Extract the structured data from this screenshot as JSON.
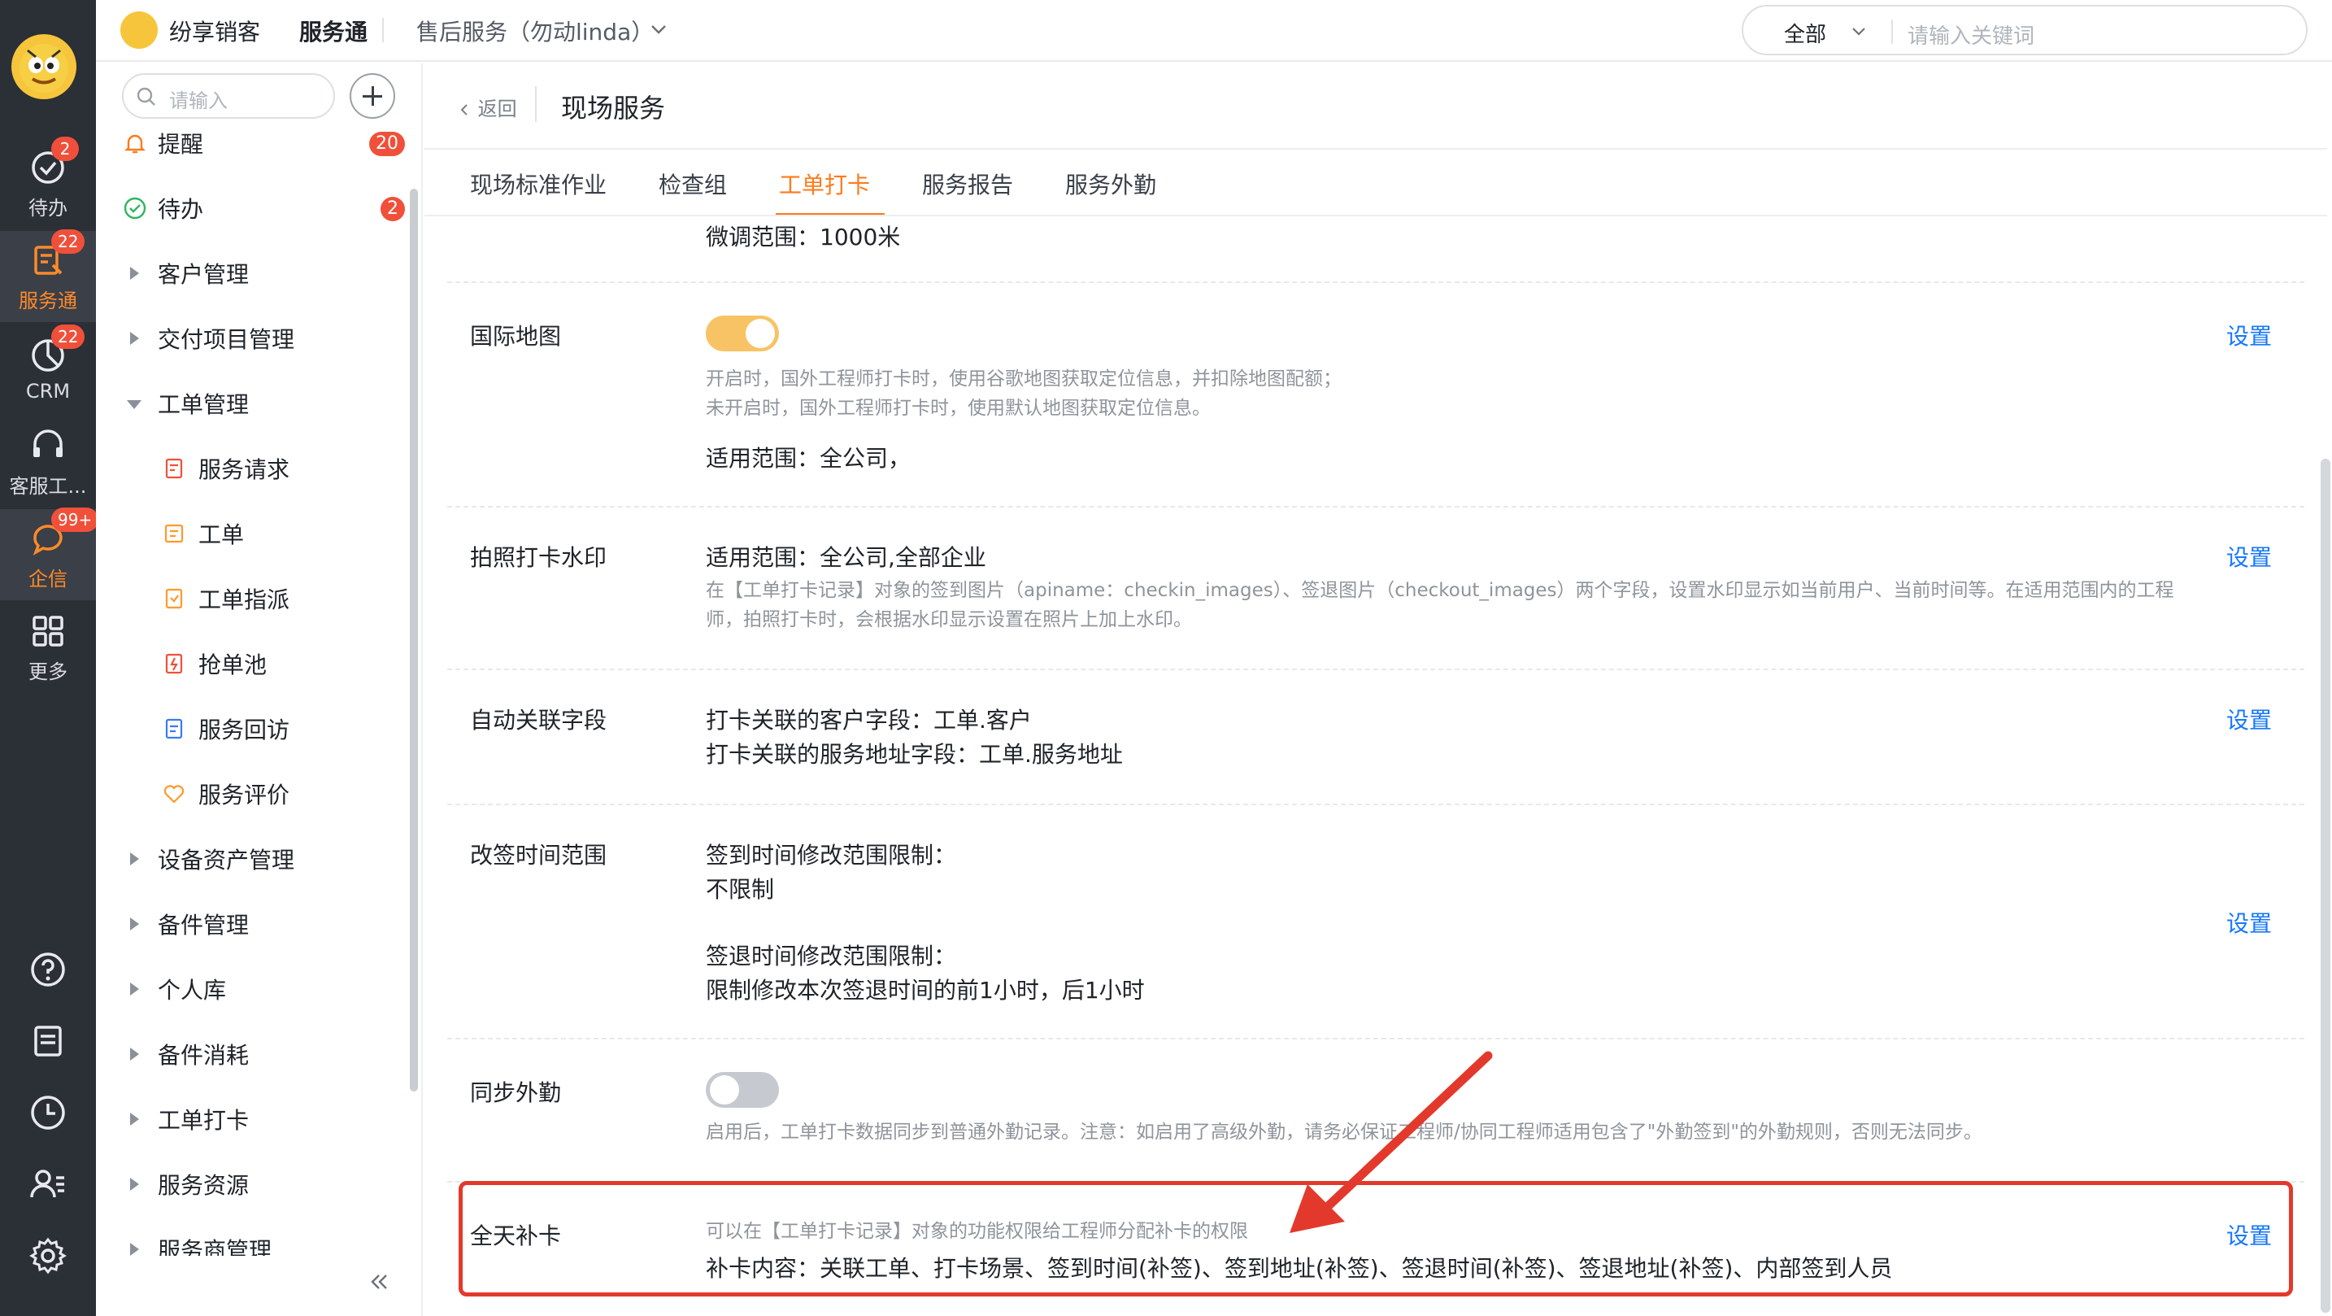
{
  "rail": {
    "items": [
      {
        "label": "待办",
        "badge": "2"
      },
      {
        "label": "服务通",
        "badge": "22"
      },
      {
        "label": "CRM",
        "badge": "22"
      },
      {
        "label": "客服工...",
        "badge": ""
      },
      {
        "label": "企信",
        "badge": "99+"
      },
      {
        "label": "更多",
        "badge": ""
      }
    ]
  },
  "header": {
    "brand_name": "纷享销客",
    "app_name": "服务通",
    "enterprise": "售后服务（勿动linda）",
    "search_scope": "全部",
    "search_placeholder": "请输入关键词"
  },
  "subnav": {
    "search_placeholder": "请输入",
    "items": [
      {
        "label": "提醒",
        "badge": "20"
      },
      {
        "label": "待办",
        "badge": "2"
      },
      {
        "label": "客户管理"
      },
      {
        "label": "交付项目管理"
      },
      {
        "label": "工单管理"
      },
      {
        "label": "服务请求"
      },
      {
        "label": "工单"
      },
      {
        "label": "工单指派"
      },
      {
        "label": "抢单池"
      },
      {
        "label": "服务回访"
      },
      {
        "label": "服务评价"
      },
      {
        "label": "设备资产管理"
      },
      {
        "label": "备件管理"
      },
      {
        "label": "个人库"
      },
      {
        "label": "备件消耗"
      },
      {
        "label": "工单打卡"
      },
      {
        "label": "服务资源"
      },
      {
        "label": "服务商管理"
      }
    ]
  },
  "page": {
    "back_label": "返回",
    "title": "现场服务",
    "tabs": [
      "现场标准作业",
      "检查组",
      "工单打卡",
      "服务报告",
      "服务外勤"
    ],
    "active_tab": "工单打卡",
    "sections": {
      "top_fragment": "微调范围：1000米",
      "intl_map": {
        "label": "国际地图",
        "enabled": true,
        "desc1": "开启时，国外工程师打卡时，使用谷歌地图获取定位信息，并扣除地图配额；",
        "desc2": "未开启时，国外工程师打卡时，使用默认地图获取定位信息。",
        "scope": "适用范围：全公司，",
        "action": "设置"
      },
      "watermark": {
        "label": "拍照打卡水印",
        "scope": "适用范围：全公司,全部企业",
        "desc1": "在【工单打卡记录】对象的签到图片（apiname：checkin_images）、签退图片（checkout_images）两个字段，设置水印显示如当前用户、当前时间等。在适用范围内的工程",
        "desc2": "师，拍照打卡时，会根据水印显示设置在照片上加上水印。",
        "action": "设置"
      },
      "auto_link": {
        "label": "自动关联字段",
        "line1": "打卡关联的客户字段：工单.客户",
        "line2": "打卡关联的服务地址字段：工单.服务地址",
        "action": "设置"
      },
      "time_range": {
        "label": "改签时间范围",
        "line1": "签到时间修改范围限制：",
        "line2": "不限制",
        "line3": "签退时间修改范围限制：",
        "line4": "限制修改本次签退时间的前1小时，后1小时",
        "action": "设置"
      },
      "sync": {
        "label": "同步外勤",
        "enabled": false,
        "desc": "启用后，工单打卡数据同步到普通外勤记录。注意：如启用了高级外勤，请务必保证工程师/协同工程师适用包含了\"外勤签到\"的外勤规则，否则无法同步。"
      },
      "makeup": {
        "label": "全天补卡",
        "desc": "可以在【工单打卡记录】对象的功能权限给工程师分配补卡的权限",
        "content": "补卡内容：关联工单、打卡场景、签到时间(补签)、签到地址(补签)、签退时间(补签)、签退地址(补签)、内部签到人员",
        "action": "设置"
      }
    }
  },
  "colors": {
    "rail_bg": "#2b2f36",
    "accent_orange": "#ff7a1a",
    "link_blue": "#1677ff",
    "badge_red": "#f0503a",
    "annotation_red": "#e3392c"
  }
}
